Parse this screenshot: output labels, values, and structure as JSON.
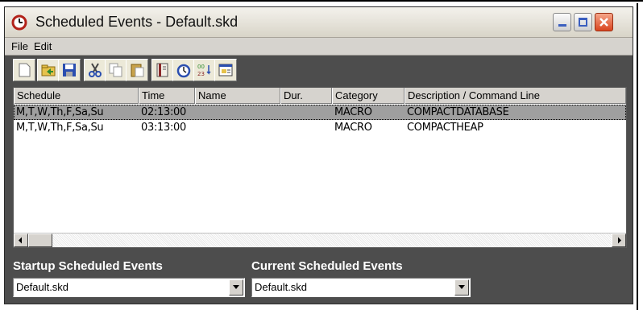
{
  "window": {
    "title": "Scheduled Events - Default.skd"
  },
  "menu": {
    "items": [
      "File",
      "Edit"
    ]
  },
  "toolbar": {
    "buttons": [
      "new-file-icon",
      "open-folder-icon",
      "save-disk-icon",
      "cut-scissors-icon",
      "copy-icon",
      "paste-icon",
      "book-icon",
      "clock-icon",
      "number-sort-icon",
      "properties-icon"
    ]
  },
  "table": {
    "columns": [
      "Schedule",
      "Time",
      "Name",
      "Dur.",
      "Category",
      "Description / Command Line"
    ],
    "rows": [
      {
        "schedule": "M,T,W,Th,F,Sa,Su",
        "time": "02:13:00",
        "name": "",
        "dur": "",
        "category": "MACRO",
        "description": "COMPACTDATABASE",
        "selected": true
      },
      {
        "schedule": "M,T,W,Th,F,Sa,Su",
        "time": "03:13:00",
        "name": "",
        "dur": "",
        "category": "MACRO",
        "description": "COMPACTHEAP",
        "selected": false
      }
    ]
  },
  "startup": {
    "label": "Startup Scheduled Events",
    "value": "Default.skd"
  },
  "current": {
    "label": "Current Scheduled Events",
    "value": "Default.skd"
  },
  "colors": {
    "window_bg": "#4d4d4d",
    "selected_row": "#9f9f9f",
    "close_button": "#d9451f"
  }
}
